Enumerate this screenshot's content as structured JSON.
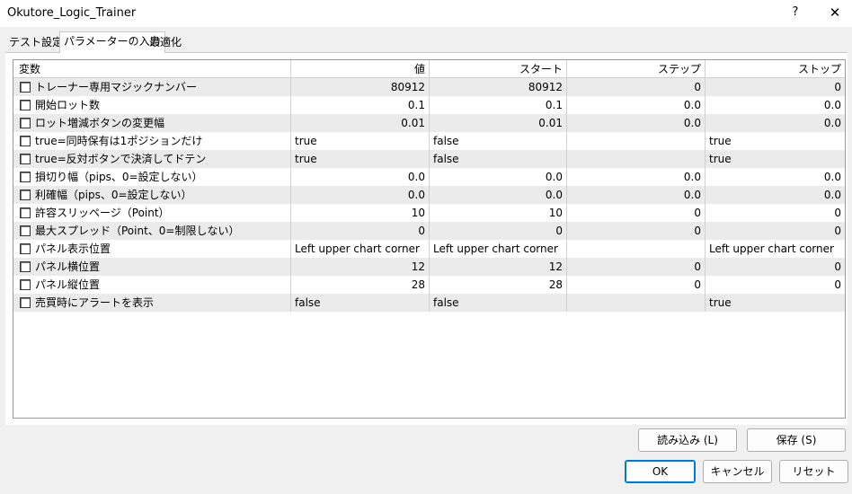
{
  "window": {
    "title": "Okutore_Logic_Trainer",
    "help_label": "?",
    "close_label": "✕"
  },
  "tabs": [
    {
      "label": "テスト設定"
    },
    {
      "label": "パラメーターの入力"
    },
    {
      "label": "最適化"
    }
  ],
  "columns": {
    "name": "変数",
    "value": "値",
    "start": "スタート",
    "step": "ステップ",
    "stop": "ストップ"
  },
  "rows": [
    {
      "name": "トレーナー専用マジックナンバー",
      "value": "80912",
      "start": "80912",
      "step": "0",
      "stop": "0"
    },
    {
      "name": "開始ロット数",
      "value": "0.1",
      "start": "0.1",
      "step": "0.0",
      "stop": "0.0"
    },
    {
      "name": "ロット増減ボタンの変更幅",
      "value": "0.01",
      "start": "0.01",
      "step": "0.0",
      "stop": "0.0"
    },
    {
      "name": "true=同時保有は1ポジションだけ",
      "value": "true",
      "start": "false",
      "step": "",
      "stop": "true"
    },
    {
      "name": "true=反対ボタンで決済してドテン",
      "value": "true",
      "start": "false",
      "step": "",
      "stop": "true"
    },
    {
      "name": "損切り幅（pips、0=設定しない）",
      "value": "0.0",
      "start": "0.0",
      "step": "0.0",
      "stop": "0.0"
    },
    {
      "name": "利確幅（pips、0=設定しない）",
      "value": "0.0",
      "start": "0.0",
      "step": "0.0",
      "stop": "0.0"
    },
    {
      "name": "許容スリッページ（Point）",
      "value": "10",
      "start": "10",
      "step": "0",
      "stop": "0"
    },
    {
      "name": "最大スプレッド（Point、0=制限しない）",
      "value": "0",
      "start": "0",
      "step": "0",
      "stop": "0"
    },
    {
      "name": "パネル表示位置",
      "value": "Left upper chart corner",
      "start": "Left upper chart corner",
      "step": "",
      "stop": "Left upper chart corner"
    },
    {
      "name": "パネル横位置",
      "value": "12",
      "start": "12",
      "step": "0",
      "stop": "0"
    },
    {
      "name": "パネル縦位置",
      "value": "28",
      "start": "28",
      "step": "0",
      "stop": "0"
    },
    {
      "name": "売買時にアラートを表示",
      "value": "false",
      "start": "false",
      "step": "",
      "stop": "true"
    }
  ],
  "buttons": {
    "load": "読み込み (L)",
    "save": "保存 (S)",
    "ok": "OK",
    "cancel": "キャンセル",
    "reset": "リセット"
  }
}
